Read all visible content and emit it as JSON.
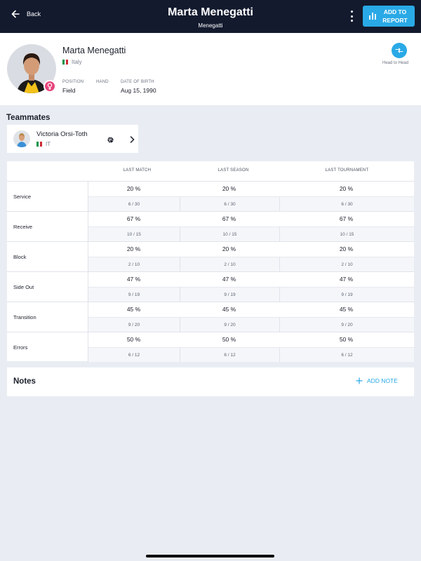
{
  "header": {
    "back_label": "Back",
    "title": "Marta Menegatti",
    "subtitle": "Menegatti",
    "add_report_label": "ADD TO REPORT"
  },
  "player": {
    "name": "Marta Menegatti",
    "country": "Italy",
    "position_label": "POSITION",
    "position_value": "Field",
    "hand_label": "HAND",
    "hand_value": "",
    "dob_label": "DATE OF BIRTH",
    "dob_value": "Aug 15, 1990",
    "head_to_head_label": "Head to Head"
  },
  "teammates": {
    "title": "Teammates",
    "items": [
      {
        "name": "Victoria Orsi-Toth",
        "country": "IT"
      }
    ]
  },
  "stats": {
    "columns": [
      "LAST MATCH",
      "LAST SEASON",
      "LAST TOURNAMENT"
    ],
    "rows": [
      {
        "label": "Service",
        "pct": [
          "20 %",
          "20 %",
          "20 %"
        ],
        "ratio": [
          "6 / 30",
          "6 / 30",
          "6 / 30"
        ]
      },
      {
        "label": "Receive",
        "pct": [
          "67 %",
          "67 %",
          "67 %"
        ],
        "ratio": [
          "10 / 15",
          "10 / 15",
          "10 / 15"
        ]
      },
      {
        "label": "Block",
        "pct": [
          "20 %",
          "20 %",
          "20 %"
        ],
        "ratio": [
          "2 / 10",
          "2 / 10",
          "2 / 10"
        ]
      },
      {
        "label": "Side Out",
        "pct": [
          "47 %",
          "47 %",
          "47 %"
        ],
        "ratio": [
          "9 / 19",
          "9 / 19",
          "9 / 19"
        ]
      },
      {
        "label": "Transition",
        "pct": [
          "45 %",
          "45 %",
          "45 %"
        ],
        "ratio": [
          "9 / 20",
          "9 / 20",
          "9 / 20"
        ]
      },
      {
        "label": "Errors",
        "pct": [
          "50 %",
          "50 %",
          "50 %"
        ],
        "ratio": [
          "6 / 12",
          "6 / 12",
          "6 / 12"
        ]
      }
    ]
  },
  "notes": {
    "title": "Notes",
    "add_label": "ADD NOTE"
  },
  "colors": {
    "topbar": "#131a2e",
    "accent": "#29a9e6",
    "gender_badge": "#e8447c",
    "background": "#e9edf3"
  },
  "icons": {
    "back": "arrow-left-icon",
    "more": "kebab-icon",
    "report": "bar-chart-icon",
    "gender": "female-icon",
    "head_to_head": "swap-icon",
    "sport": "volleyball-icon",
    "chevron": "chevron-right-icon",
    "add": "plus-icon"
  }
}
